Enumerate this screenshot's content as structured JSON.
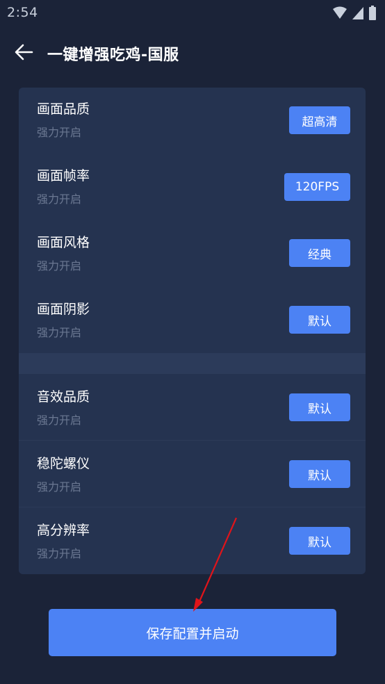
{
  "status_bar": {
    "time": "2:54"
  },
  "header": {
    "title": "一键增强吃鸡-国服"
  },
  "settings_group_1": [
    {
      "title": "画面品质",
      "subtitle": "强力开启",
      "value": "超高清"
    },
    {
      "title": "画面帧率",
      "subtitle": "强力开启",
      "value": "120FPS"
    },
    {
      "title": "画面风格",
      "subtitle": "强力开启",
      "value": "经典"
    },
    {
      "title": "画面阴影",
      "subtitle": "强力开启",
      "value": "默认"
    }
  ],
  "settings_group_2": [
    {
      "title": "音效品质",
      "subtitle": "强力开启",
      "value": "默认"
    },
    {
      "title": "稳陀螺仪",
      "subtitle": "强力开启",
      "value": "默认"
    },
    {
      "title": "高分辨率",
      "subtitle": "强力开启",
      "value": "默认"
    }
  ],
  "save_button": {
    "label": "保存配置并启动"
  },
  "icons": {
    "back": "arrow-left-icon",
    "wifi": "wifi-icon",
    "signal": "cell-signal-icon",
    "battery": "battery-icon"
  },
  "colors": {
    "background": "#1b2338",
    "card": "#253350",
    "accent": "#4c82f4",
    "annotation": "#e0141a"
  }
}
